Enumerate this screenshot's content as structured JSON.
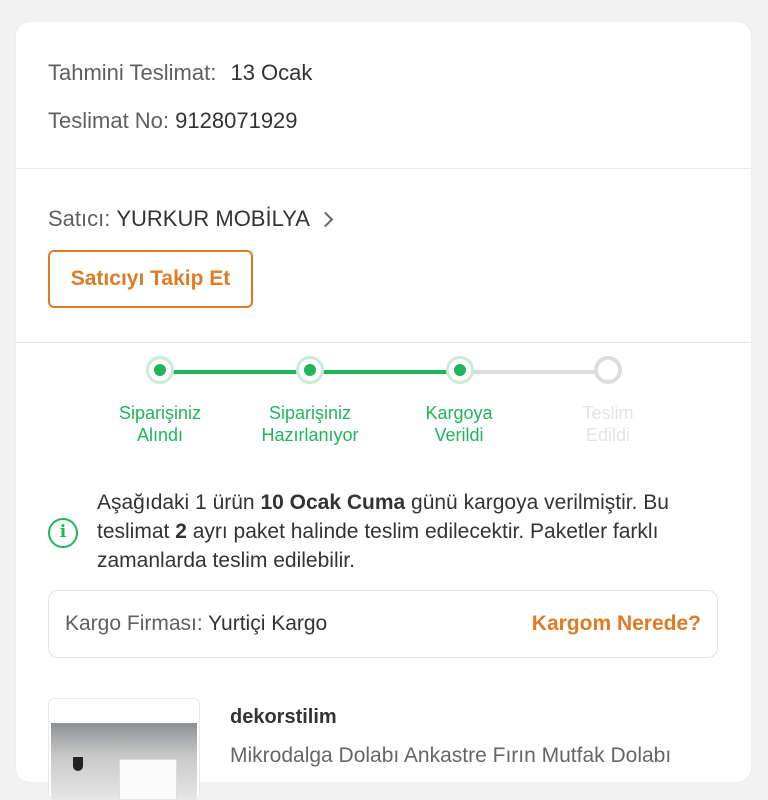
{
  "delivery": {
    "estimated_label": "Tahmini Teslimat:",
    "estimated_value": "13 Ocak",
    "number_label": "Teslimat No:",
    "number_value": "9128071929"
  },
  "seller": {
    "label": "Satıcı:",
    "name": "YURKUR MOBİLYA",
    "follow_button": "Satıcıyı Takip Et"
  },
  "tracker": {
    "steps": [
      {
        "label": "Siparişiniz\nAlındı",
        "status": "done"
      },
      {
        "label": "Siparişiniz\nHazırlanıyor",
        "status": "done"
      },
      {
        "label": "Kargoya\nVerildi",
        "status": "done"
      },
      {
        "label": "Teslim\nEdildi",
        "status": "pending"
      }
    ]
  },
  "info": {
    "part1": "Aşağıdaki 1 ürün ",
    "date": "10 Ocak Cuma",
    "part2": " günü kargoya verilmiştir. Bu teslimat ",
    "count": "2",
    "part3": " ayrı paket halinde teslim edilecektir. Paketler farklı zamanlarda teslim edilebilir."
  },
  "cargo": {
    "label": "Kargo Firması:",
    "company": "Yurtiçi Kargo",
    "link": "Kargom Nerede?"
  },
  "product": {
    "store": "dekorstilim",
    "title": "Mikrodalga Dolabı Ankastre Fırın Mutfak Dolabı"
  },
  "colors": {
    "accent_orange": "#e07a24",
    "success_green": "#1fb55a",
    "pending_gray": "#dddddd"
  }
}
